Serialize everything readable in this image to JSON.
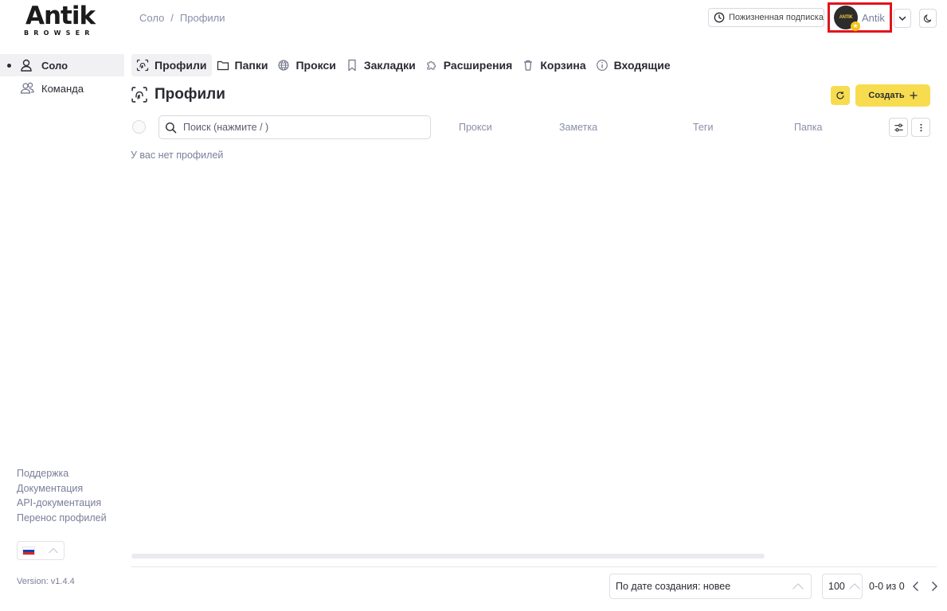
{
  "logo": {
    "main": "Antik",
    "sub": "BROWSER"
  },
  "breadcrumb": {
    "items": [
      "Соло",
      "Профили"
    ],
    "separator": "/"
  },
  "header": {
    "subscription_label": "Пожизненная подписка",
    "user_name": "Antik",
    "avatar_text": "ANTIK"
  },
  "sidebar": {
    "items": [
      {
        "label": "Соло",
        "icon": "user-icon",
        "active": true
      },
      {
        "label": "Команда",
        "icon": "users-icon",
        "active": false
      }
    ],
    "links": [
      "Поддержка",
      "Документация",
      "API-документация",
      "Перенос профилей"
    ],
    "language": "ru",
    "version": "Version: v1.4.4"
  },
  "tabs": [
    {
      "label": "Профили",
      "icon": "fingerprint-icon",
      "active": true
    },
    {
      "label": "Папки",
      "icon": "folder-icon"
    },
    {
      "label": "Прокси",
      "icon": "globe-icon"
    },
    {
      "label": "Закладки",
      "icon": "bookmark-icon"
    },
    {
      "label": "Расширения",
      "icon": "puzzle-icon"
    },
    {
      "label": "Корзина",
      "icon": "trash-icon"
    },
    {
      "label": "Входящие",
      "icon": "info-icon"
    }
  ],
  "main": {
    "title": "Профили",
    "create_label": "Создать",
    "search_placeholder": "Поиск (нажмите / )",
    "columns": [
      "Прокси",
      "Заметка",
      "Теги",
      "Папка"
    ],
    "empty_text": "У вас нет профилей"
  },
  "footer": {
    "sort_value": "По дате создания: новее",
    "per_page": "100",
    "range": "0-0 из 0"
  },
  "colors": {
    "accent": "#f7dc4f",
    "highlight": "#e2141c",
    "muted": "#8a8ea8"
  }
}
